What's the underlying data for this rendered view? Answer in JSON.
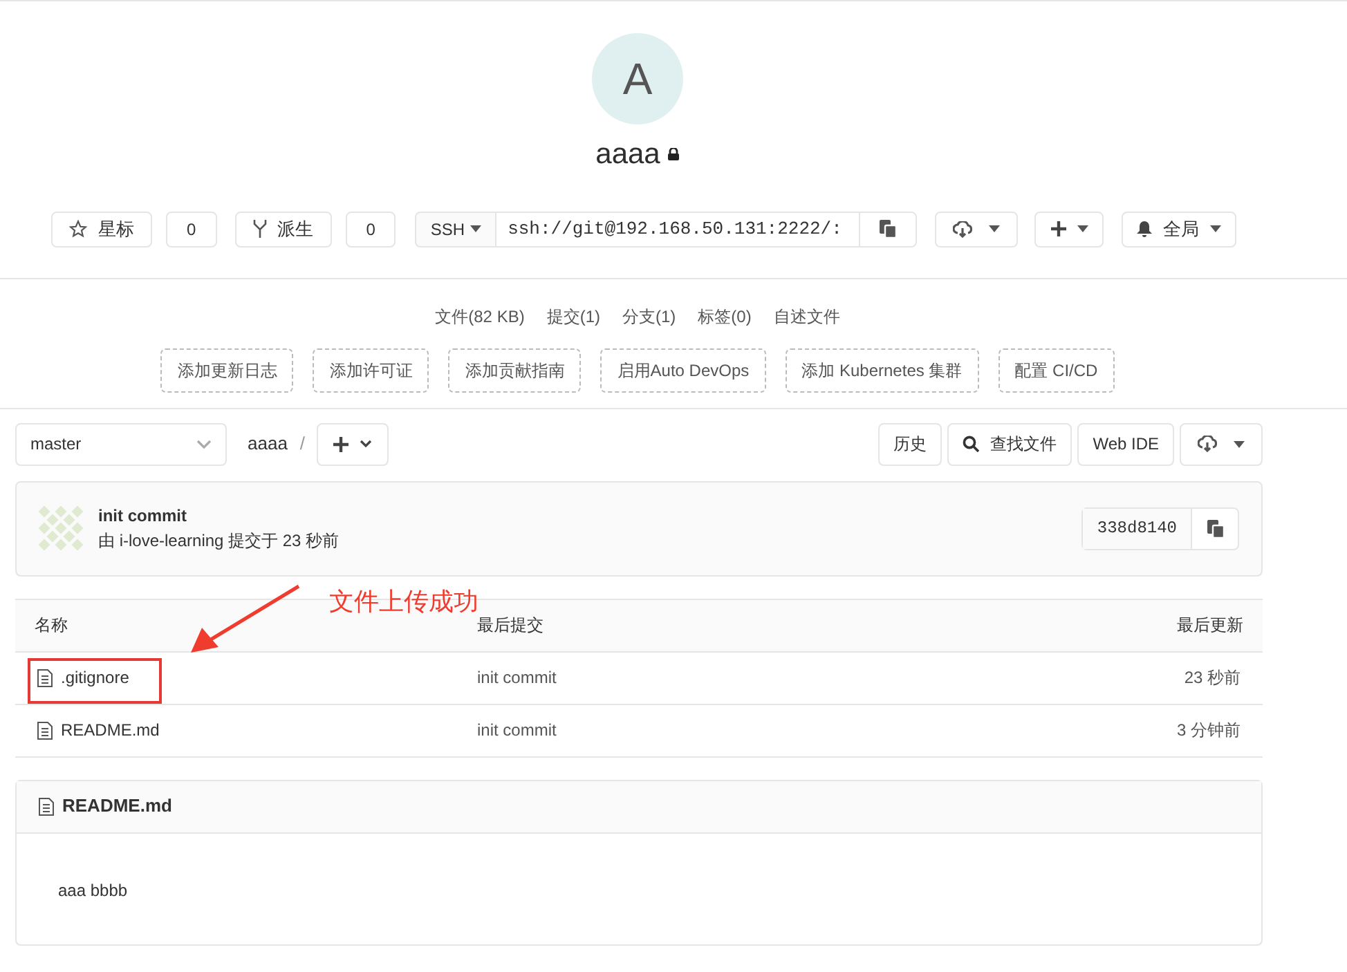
{
  "project": {
    "avatar_letter": "A",
    "name": "aaaa",
    "private": true
  },
  "star": {
    "label": "星标",
    "count": "0"
  },
  "fork": {
    "label": "派生",
    "count": "0"
  },
  "clone": {
    "protocol": "SSH",
    "url": "ssh://git@192.168.50.131:2222/:"
  },
  "notification": {
    "label": "全局"
  },
  "stats": [
    "文件(82 KB)",
    "提交(1)",
    "分支(1)",
    "标签(0)",
    "自述文件"
  ],
  "quick_actions": [
    "添加更新日志",
    "添加许可证",
    "添加贡献指南",
    "启用Auto DevOps",
    "添加 Kubernetes 集群",
    "配置 CI/CD"
  ],
  "repo_bar": {
    "branch": "master",
    "path": "aaaa",
    "separator": "/",
    "buttons": [
      {
        "kind": "text",
        "label": "历史"
      },
      {
        "kind": "search",
        "label": "查找文件"
      },
      {
        "kind": "text",
        "label": "Web IDE"
      }
    ]
  },
  "last_commit": {
    "title": "init commit",
    "meta": "由 i-love-learning 提交于 23 秒前",
    "sha": "338d8140"
  },
  "table": {
    "columns": [
      "名称",
      "最后提交",
      "最后更新"
    ],
    "rows": [
      {
        "name": ".gitignore",
        "commit": "init commit",
        "updated": "23 秒前",
        "highlighted": true
      },
      {
        "name": "README.md",
        "commit": "init commit",
        "updated": "3 分钟前",
        "highlighted": false
      }
    ]
  },
  "readme": {
    "title": "README.md",
    "content": "aaa bbbb"
  },
  "annotation": {
    "text": "文件上传成功"
  }
}
